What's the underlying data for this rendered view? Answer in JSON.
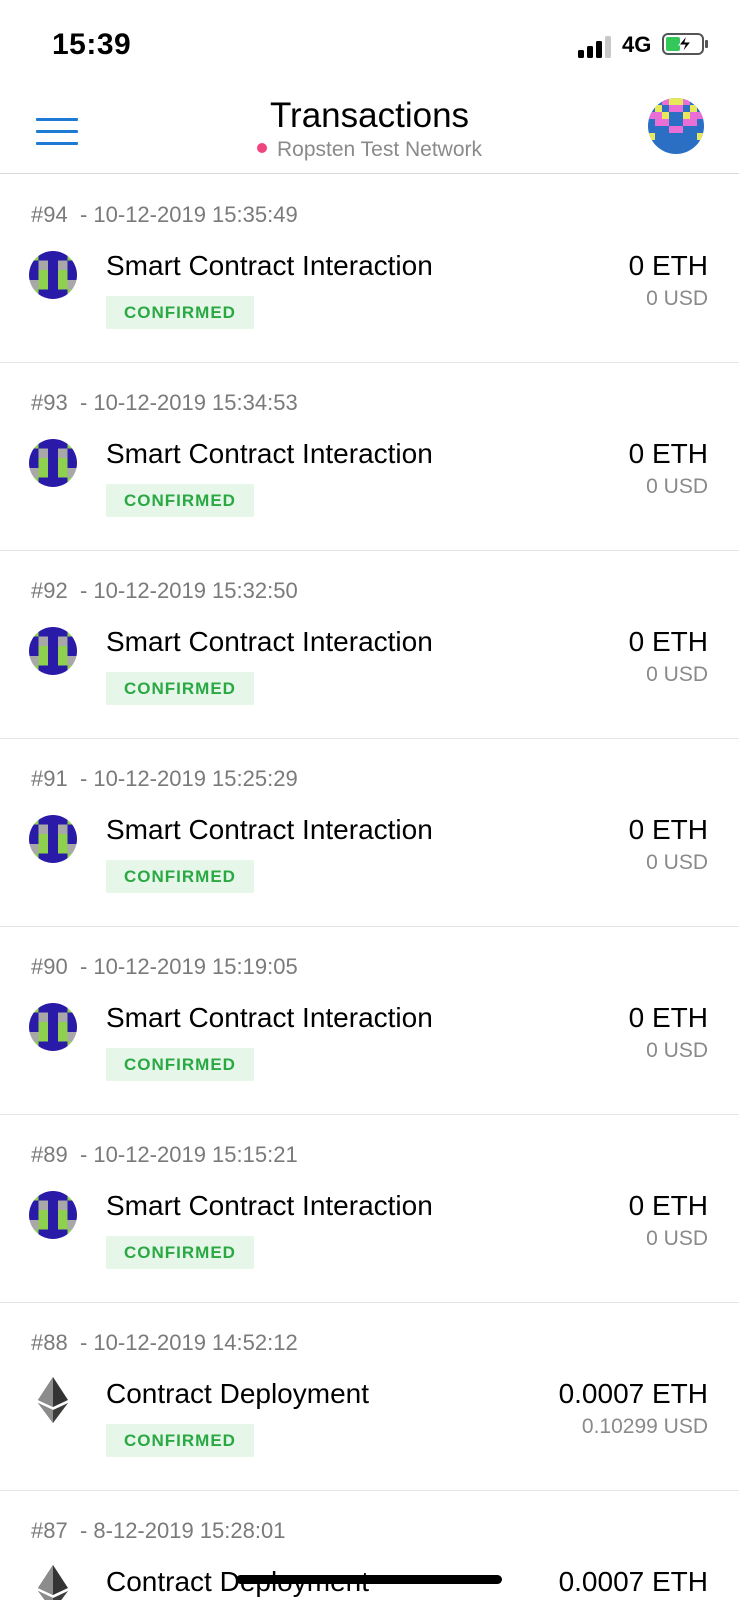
{
  "status_bar": {
    "time": "15:39",
    "network": "4G",
    "battery_color": "#34c759"
  },
  "header": {
    "title": "Transactions",
    "network_name": "Ropsten Test Network",
    "network_dot_color": "#f0447e",
    "menu_icon": "hamburger-menu-icon",
    "avatar_icon": "account-identicon"
  },
  "transactions": [
    {
      "nonce": "#94",
      "date": "10-12-2019 15:35:49",
      "title": "Smart Contract Interaction",
      "status": "CONFIRMED",
      "amount": "0 ETH",
      "fiat": "0 USD",
      "icon": "contract-identicon"
    },
    {
      "nonce": "#93",
      "date": "10-12-2019 15:34:53",
      "title": "Smart Contract Interaction",
      "status": "CONFIRMED",
      "amount": "0 ETH",
      "fiat": "0 USD",
      "icon": "contract-identicon"
    },
    {
      "nonce": "#92",
      "date": "10-12-2019 15:32:50",
      "title": "Smart Contract Interaction",
      "status": "CONFIRMED",
      "amount": "0 ETH",
      "fiat": "0 USD",
      "icon": "contract-identicon"
    },
    {
      "nonce": "#91",
      "date": "10-12-2019 15:25:29",
      "title": "Smart Contract Interaction",
      "status": "CONFIRMED",
      "amount": "0 ETH",
      "fiat": "0 USD",
      "icon": "contract-identicon"
    },
    {
      "nonce": "#90",
      "date": "10-12-2019 15:19:05",
      "title": "Smart Contract Interaction",
      "status": "CONFIRMED",
      "amount": "0 ETH",
      "fiat": "0 USD",
      "icon": "contract-identicon"
    },
    {
      "nonce": "#89",
      "date": "10-12-2019 15:15:21",
      "title": "Smart Contract Interaction",
      "status": "CONFIRMED",
      "amount": "0 ETH",
      "fiat": "0 USD",
      "icon": "contract-identicon"
    },
    {
      "nonce": "#88",
      "date": "10-12-2019 14:52:12",
      "title": "Contract Deployment",
      "status": "CONFIRMED",
      "amount": "0.0007 ETH",
      "fiat": "0.10299 USD",
      "icon": "ethereum-icon"
    },
    {
      "nonce": "#87",
      "date": "8-12-2019 15:28:01",
      "title": "Contract Deployment",
      "status": "",
      "amount": "0.0007 ETH",
      "fiat": "",
      "icon": "ethereum-icon"
    }
  ],
  "colors": {
    "accent": "#1d7bd6",
    "confirmed_text": "#2aa844",
    "confirmed_bg": "#e6f7ea",
    "identicon_green": "#8fd14f",
    "identicon_navy": "#2a1aa8",
    "identicon_gray": "#a8a8a8",
    "avatar_blue": "#2b6fc4",
    "avatar_pink": "#e96fd6",
    "avatar_yellow": "#e8e85a"
  }
}
